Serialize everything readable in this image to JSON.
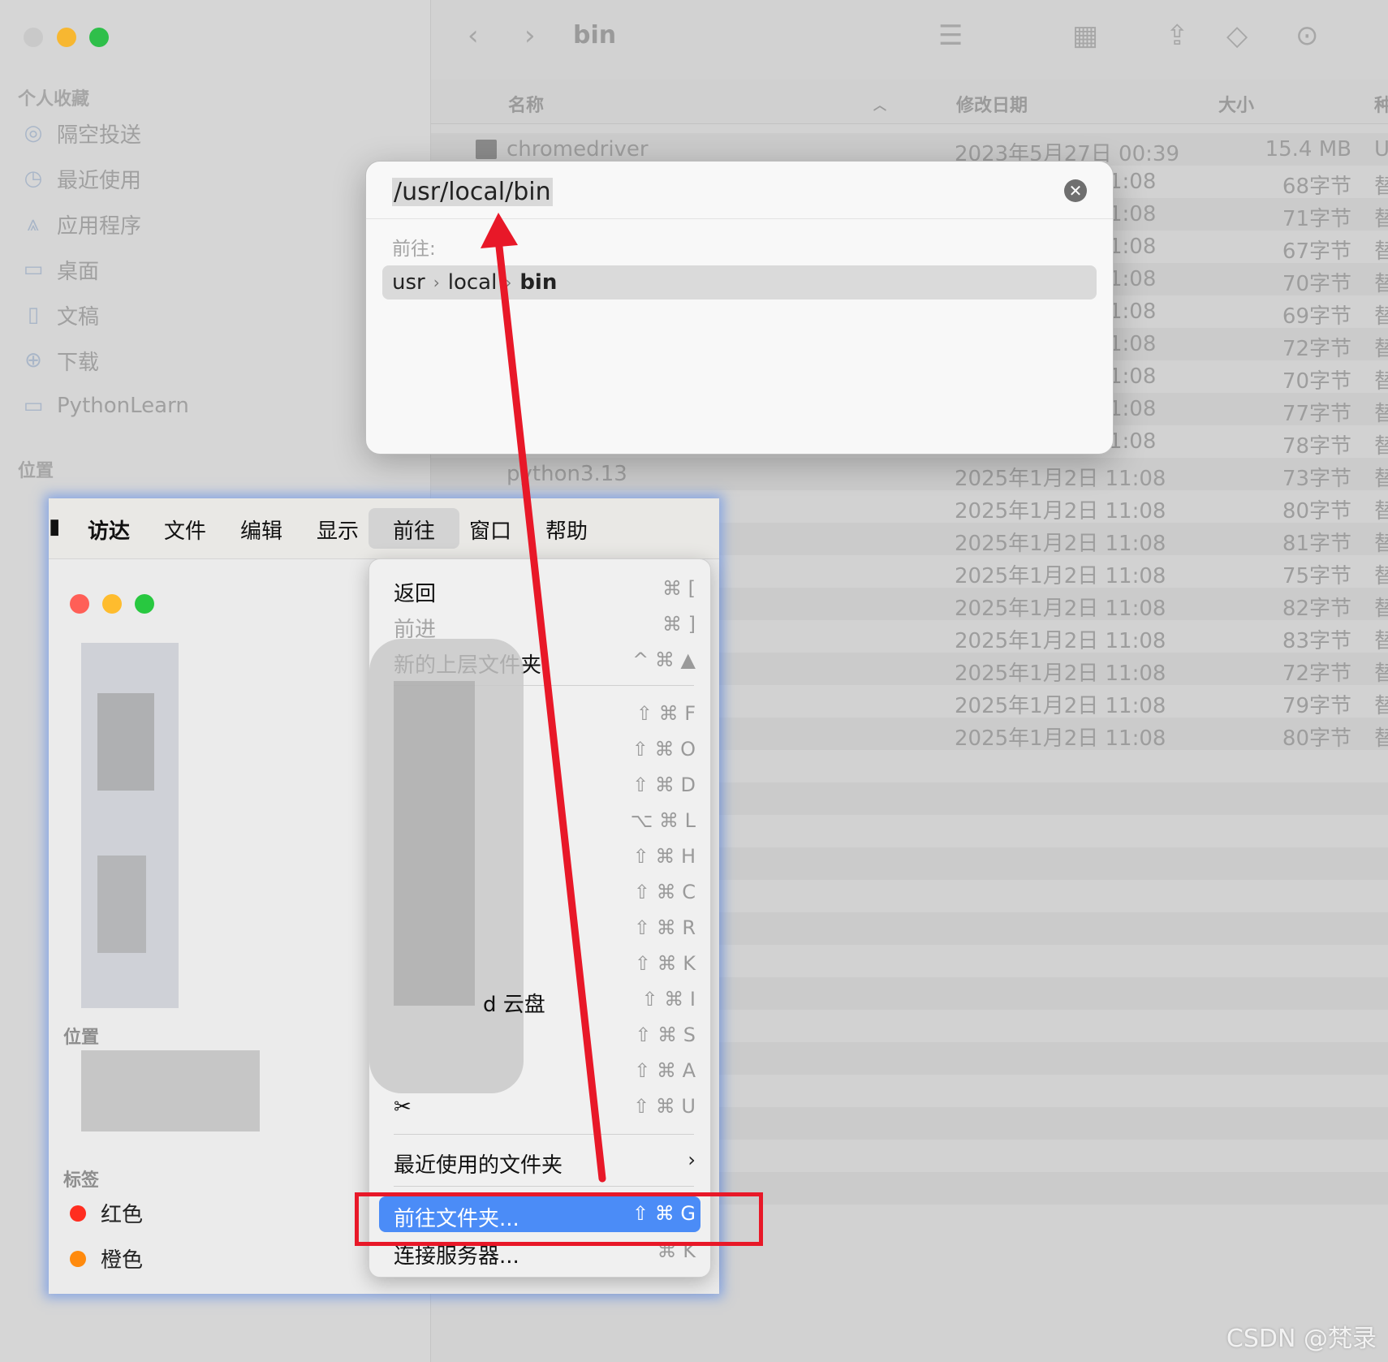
{
  "finder": {
    "title": "bin",
    "sidebar": {
      "favorites_header": "个人收藏",
      "favorites": [
        "隔空投送",
        "最近使用",
        "应用程序",
        "桌面",
        "文稿",
        "下载",
        "PythonLearn"
      ],
      "locations_header": "位置",
      "tags_header": "标签"
    },
    "columns": {
      "name": "名称",
      "date": "修改日期",
      "size": "大小",
      "kind": "种"
    },
    "first_row": {
      "name": "chromedriver",
      "date": "2023年5月27日 00:39",
      "size": "15.4 MB",
      "kind": "U"
    },
    "partial_times": [
      "1:08",
      "1:08",
      "1:08",
      "1:08",
      "1:08",
      "1:08",
      "1:08",
      "1:08",
      "1:08"
    ],
    "partial_sizes": [
      "68字节",
      "71字节",
      "67字节",
      "70字节",
      "69字节",
      "72字节",
      "70字节",
      "77字节",
      "78字节"
    ],
    "python_row": {
      "name": "python3.13",
      "date": "2025年1月2日 11:08",
      "size": "73字节"
    },
    "rows": [
      {
        "date": "2025年1月2日 11:08",
        "size": "80字节"
      },
      {
        "date": "2025年1月2日 11:08",
        "size": "81字节"
      },
      {
        "date": "2025年1月2日 11:08",
        "size": "75字节"
      },
      {
        "date": "2025年1月2日 11:08",
        "size": "82字节"
      },
      {
        "date": "2025年1月2日 11:08",
        "size": "83字节"
      },
      {
        "date": "2025年1月2日 11:08",
        "size": "72字节"
      },
      {
        "date": "2025年1月2日 11:08",
        "size": "79字节"
      },
      {
        "date": "2025年1月2日 11:08",
        "size": "80字节"
      }
    ],
    "kind_glyph": "替"
  },
  "goto_dialog": {
    "input_value": "/usr/local/bin",
    "label": "前往:",
    "path": [
      "usr",
      "local",
      "bin"
    ]
  },
  "inset": {
    "menubar": [
      "访达",
      "文件",
      "编辑",
      "显示",
      "前往",
      "窗口",
      "帮助"
    ],
    "locations_header": "位置",
    "tags_header": "标签",
    "tags": [
      {
        "name": "红色",
        "color": "#ff2d20"
      },
      {
        "name": "橙色",
        "color": "#ff8a0d"
      }
    ]
  },
  "go_menu": {
    "items": [
      {
        "label": "返回",
        "shortcut": "⌘ [",
        "dim": false
      },
      {
        "label": "前进",
        "shortcut": "⌘ ]",
        "dim": true
      },
      {
        "label": "新的上层文件夹",
        "shortcut": "^ ⌘ ▲",
        "dim": false
      }
    ],
    "shortcuts": [
      "⇧ ⌘ F",
      "⇧ ⌘ O",
      "⇧ ⌘ D",
      "⌥ ⌘ L",
      "⇧ ⌘ H",
      "⇧ ⌘ C",
      "⇧ ⌘ R",
      "⇧ ⌘ K",
      "⇧ ⌘ I",
      "⇧ ⌘ S",
      "⇧ ⌘ A",
      "⇧ ⌘ U"
    ],
    "icloud_fragment": "d 云盘",
    "recent_folders": "最近使用的文件夹",
    "goto_folder": {
      "label": "前往文件夹...",
      "shortcut": "⇧ ⌘ G"
    },
    "connect_server": {
      "label": "连接服务器...",
      "shortcut": "⌘ K"
    }
  },
  "watermark": "CSDN @梵录",
  "colors": {
    "highlight": "#4b8cf7",
    "annotation_red": "#e81828"
  }
}
